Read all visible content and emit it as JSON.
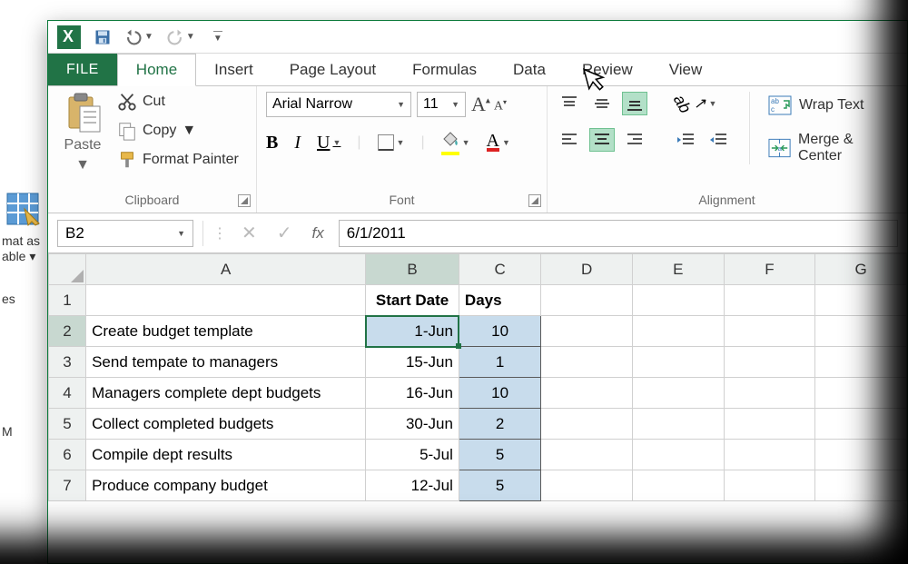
{
  "qat": {
    "save": "save",
    "undo": "undo",
    "redo": "redo"
  },
  "tabs": {
    "file": "FILE",
    "home": "Home",
    "insert": "Insert",
    "pagelayout": "Page Layout",
    "formulas": "Formulas",
    "data": "Data",
    "review": "Review",
    "view": "View"
  },
  "clipboard": {
    "paste": "Paste",
    "cut": "Cut",
    "copy": "Copy",
    "formatpainter": "Format Painter",
    "group": "Clipboard"
  },
  "font": {
    "name": "Arial Narrow",
    "size": "11",
    "group": "Font"
  },
  "alignment": {
    "wrap": "Wrap Text",
    "merge": "Merge & Center",
    "group": "Alignment"
  },
  "left_sliver": {
    "l1": "mat as",
    "l2": "able ▾",
    "l3": "es",
    "l4": "M"
  },
  "namebox": "B2",
  "formula": "6/1/2011",
  "columns": [
    "A",
    "B",
    "C",
    "D",
    "E",
    "F",
    "G"
  ],
  "headers": {
    "b": "Start Date",
    "c": "Days"
  },
  "rows": [
    {
      "n": "2",
      "a": "Create budget template",
      "b": "1-Jun",
      "c": "10"
    },
    {
      "n": "3",
      "a": "Send tempate to managers",
      "b": "15-Jun",
      "c": "1"
    },
    {
      "n": "4",
      "a": "Managers complete dept budgets",
      "b": "16-Jun",
      "c": "10"
    },
    {
      "n": "5",
      "a": "Collect completed budgets",
      "b": "30-Jun",
      "c": "2"
    },
    {
      "n": "6",
      "a": "Compile dept results",
      "b": "5-Jul",
      "c": "5"
    },
    {
      "n": "7",
      "a": "Produce company budget",
      "b": "12-Jul",
      "c": "5"
    }
  ]
}
